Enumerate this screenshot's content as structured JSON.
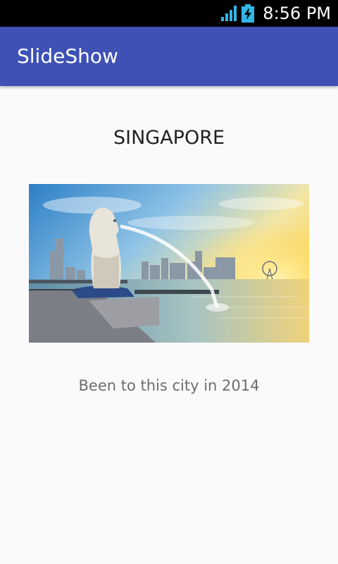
{
  "status_bar": {
    "time": "8:56 PM",
    "signal_icon": "cell-signal-icon",
    "battery_icon": "battery-charging-icon"
  },
  "app_bar": {
    "title": "SlideShow",
    "color": "#3f51b5"
  },
  "slide": {
    "title": "SINGAPORE",
    "image_alt": "Merlion fountain and Singapore skyline at sunset",
    "caption": "Been to this city in 2014"
  }
}
